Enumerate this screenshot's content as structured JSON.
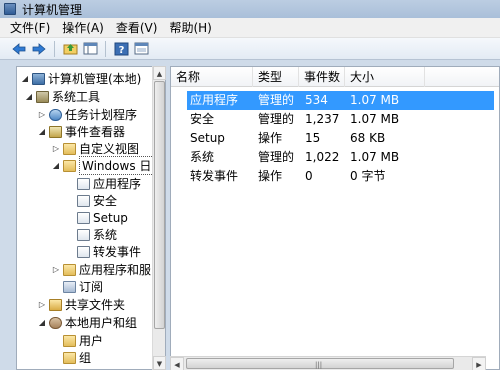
{
  "window": {
    "title": "计算机管理"
  },
  "menu": [
    "文件(F)",
    "操作(A)",
    "查看(V)",
    "帮助(H)"
  ],
  "toolbar": {
    "icons": [
      "back-arrow-icon",
      "forward-arrow-icon",
      "up-folder-icon",
      "show-tree-icon",
      "help-icon",
      "properties-icon"
    ]
  },
  "tree": {
    "items": [
      {
        "label": "计算机管理(本地)",
        "icon": "computer-icon"
      },
      {
        "label": "系统工具",
        "icon": "tools-icon"
      },
      {
        "label": "任务计划程序",
        "icon": "task-scheduler-icon"
      },
      {
        "label": "事件查看器",
        "icon": "event-viewer-icon"
      },
      {
        "label": "自定义视图",
        "icon": "folder-icon"
      },
      {
        "label": "Windows 日",
        "icon": "folder-icon"
      },
      {
        "label": "应用程序",
        "icon": "log-icon"
      },
      {
        "label": "安全",
        "icon": "log-icon"
      },
      {
        "label": "Setup",
        "icon": "log-icon"
      },
      {
        "label": "系统",
        "icon": "log-icon"
      },
      {
        "label": "转发事件",
        "icon": "log-icon"
      },
      {
        "label": "应用程序和服",
        "icon": "folder-icon"
      },
      {
        "label": "订阅",
        "icon": "subscription-icon"
      },
      {
        "label": "共享文件夹",
        "icon": "shared-folder-icon"
      },
      {
        "label": "本地用户和组",
        "icon": "users-icon"
      },
      {
        "label": "用户",
        "icon": "folder-icon"
      },
      {
        "label": "组",
        "icon": "folder-icon"
      }
    ]
  },
  "list": {
    "columns": [
      "名称",
      "类型",
      "事件数",
      "大小"
    ],
    "rows": [
      {
        "name": "应用程序",
        "type": "管理的",
        "count": "534",
        "size": "1.07 MB"
      },
      {
        "name": "安全",
        "type": "管理的",
        "count": "1,237",
        "size": "1.07 MB"
      },
      {
        "name": "Setup",
        "type": "操作",
        "count": "15",
        "size": "68 KB"
      },
      {
        "name": "系统",
        "type": "管理的",
        "count": "1,022",
        "size": "1.07 MB"
      },
      {
        "name": "转发事件",
        "type": "操作",
        "count": "0",
        "size": "0 字节"
      }
    ]
  }
}
